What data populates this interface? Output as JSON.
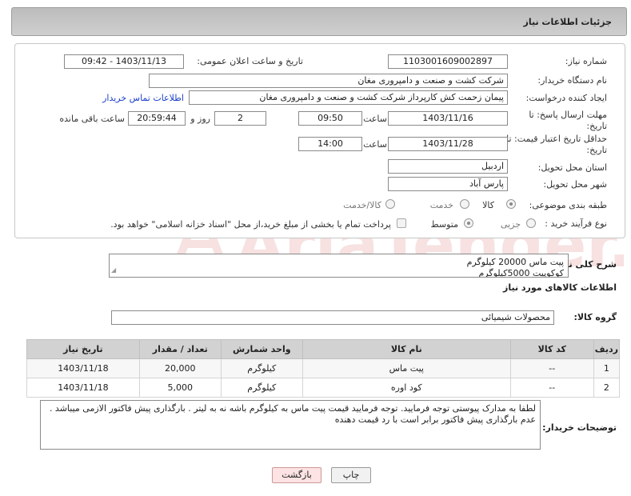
{
  "header": {
    "title": "جزئیات اطلاعات نیاز"
  },
  "form": {
    "need_number_label": "شماره نیاز:",
    "need_number": "1103001609002897",
    "announce_label": "تاریخ و ساعت اعلان عمومی:",
    "announce_value": "1403/11/13 - 09:42",
    "buyer_org_label": "نام دستگاه خریدار:",
    "buyer_org": "شرکت کشت و صنعت و دامپروری مغان",
    "creator_label": "ایجاد کننده درخواست:",
    "creator": "پیمان زحمت کش کارپرداز شرکت کشت و صنعت و دامپروری مغان",
    "contact_link": "اطلاعات تماس خریدار",
    "reply_deadline_label_1": "مهلت ارسال پاسخ: تا",
    "reply_deadline_label_2": "تاریخ:",
    "reply_date": "1403/11/16",
    "time_label": "ساعت",
    "reply_time": "09:50",
    "days_value": "2",
    "days_label": "روز و",
    "remaining_time": "20:59:44",
    "remaining_label": "ساعت باقی مانده",
    "validity_label_1": "حداقل تاریخ اعتبار قیمت: تا",
    "validity_label_2": "تاریخ:",
    "validity_date": "1403/11/28",
    "validity_time": "14:00",
    "province_label": "استان محل تحویل:",
    "province": "اردبیل",
    "city_label": "شهر محل تحویل:",
    "city": "پارس آباد",
    "category_label": "طبقه بندی موضوعی:",
    "category_options": [
      "کالا",
      "خدمت",
      "کالا/خدمت"
    ],
    "process_label": "نوع فرآیند خرید :",
    "process_options": [
      "جزیی",
      "متوسط"
    ],
    "payment_note": "پرداخت تمام یا بخشی از مبلغ خرید،از محل \"اسناد خزانه اسلامی\" خواهد بود."
  },
  "summary": {
    "label": "شرح کلی نیاز:",
    "line1": "پیت ماس 20000 کیلوگرم",
    "line2": "کوکوپیت 5000کیلوگرم"
  },
  "goods_section": {
    "heading": "اطلاعات کالاهای مورد نیاز",
    "group_label": "گروه کالا:",
    "group_value": "محصولات شیمیائی"
  },
  "table": {
    "headers": [
      "ردیف",
      "کد کالا",
      "نام کالا",
      "واحد شمارش",
      "تعداد / مقدار",
      "تاریخ نیاز"
    ],
    "rows": [
      [
        "1",
        "--",
        "پیت ماس",
        "کیلوگرم",
        "20,000",
        "1403/11/18"
      ],
      [
        "2",
        "--",
        "کود اوره",
        "کیلوگرم",
        "5,000",
        "1403/11/18"
      ]
    ]
  },
  "notes": {
    "label": "توضیحات خریدار:",
    "text": "لطفا به مدارک پیوستی توجه فرمایید. توجه فرمایید قیمت پیت ماس به کیلوگرم باشه نه به لیتر . بارگذاری پیش فاکتور الازمی میباشد . عدم بارگذاری پیش فاکتور برابر است با رد قیمت دهندە"
  },
  "buttons": {
    "print": "چاپ",
    "back": "بازگشت"
  },
  "watermark_text": "AriaTender.neT",
  "colors": {
    "link": "#1a3fc9",
    "header_bg": "#c6c6c6",
    "back_button": "#fde3e3"
  }
}
